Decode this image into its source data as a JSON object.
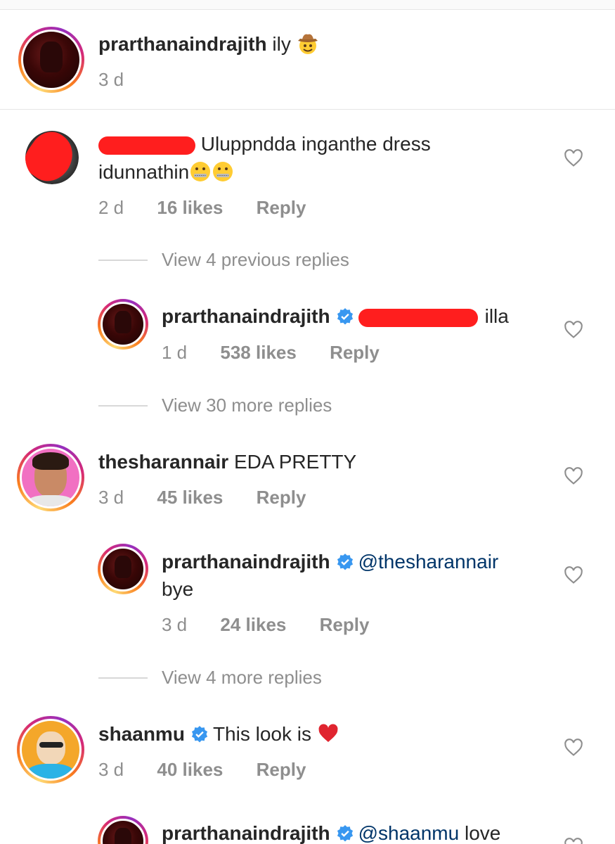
{
  "caption": {
    "username": "prarthanaindrajith",
    "text": "ily",
    "emoji": "cowboy-emoji",
    "time": "3 d"
  },
  "comments": [
    {
      "username_redacted": true,
      "text_line1": "Uluppndda inganthe dress",
      "text_line2": "idunnathin",
      "emoji": "zipper-mouth-emoji",
      "time": "2 d",
      "likes": "16 likes",
      "reply": "Reply",
      "view_replies": "View 4 previous replies",
      "replies": [
        {
          "username": "prarthanaindrajith",
          "verified": true,
          "mention_redacted": true,
          "text": "illa",
          "time": "1 d",
          "likes": "538 likes",
          "reply": "Reply"
        }
      ],
      "view_more": "View 30 more replies"
    },
    {
      "username": "thesharannair",
      "text": "EDA PRETTY",
      "time": "3 d",
      "likes": "45 likes",
      "reply": "Reply",
      "replies": [
        {
          "username": "prarthanaindrajith",
          "verified": true,
          "mention": "@thesharannair",
          "text": "bye",
          "time": "3 d",
          "likes": "24 likes",
          "reply": "Reply"
        }
      ],
      "view_more": "View 4 more replies"
    },
    {
      "username": "shaanmu",
      "verified": true,
      "text": "This look is",
      "emoji": "red-heart-emoji",
      "time": "3 d",
      "likes": "40 likes",
      "reply": "Reply",
      "replies": [
        {
          "username": "prarthanaindrajith",
          "verified": true,
          "mention": "@shaanmu",
          "text": "love"
        }
      ]
    }
  ],
  "colors": {
    "text": "#262626",
    "secondary": "#8e8e8e",
    "verified": "#3897f0",
    "mention": "#003569",
    "redaction": "#ff1e1e"
  }
}
